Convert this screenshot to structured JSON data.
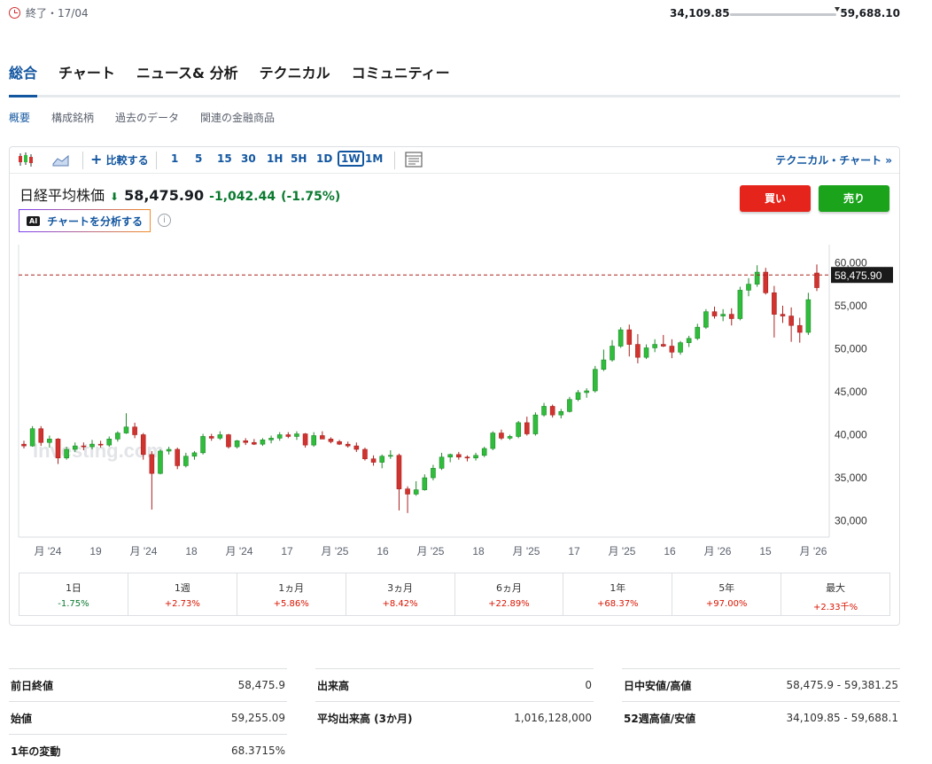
{
  "status": {
    "label": "終了・17/04"
  },
  "range52": {
    "label": "52週高値/安値",
    "low": "34,109.85",
    "high": "59,688.10"
  },
  "tabs": [
    {
      "label": "総合",
      "active": true
    },
    {
      "label": "チャート"
    },
    {
      "label": "ニュース& 分析"
    },
    {
      "label": "テクニカル"
    },
    {
      "label": "コミュニティー"
    }
  ],
  "subtabs": [
    {
      "label": "概要",
      "active": true
    },
    {
      "label": "構成銘柄"
    },
    {
      "label": "過去のデータ"
    },
    {
      "label": "関連の金融商品"
    }
  ],
  "toolbar": {
    "compare": "比較する",
    "intervals": [
      "1",
      "5",
      "15",
      "30",
      "1H",
      "5H",
      "1D",
      "1W",
      "1M"
    ],
    "selected_interval": "1W",
    "technical_link": "テクニカル・チャート »"
  },
  "instrument": {
    "name": "日経平均株価",
    "price": "58,475.90",
    "change": "-1,042.44",
    "change_pct": "(-1.75%)"
  },
  "ai_button": {
    "badge": "AI",
    "label": "チャートを分析する"
  },
  "buy_label": "買い",
  "sell_label": "売り",
  "chart_data": {
    "type": "candlestick",
    "current_price_label": "58,475.90",
    "current_price": 58475.9,
    "ylim": [
      28000,
      62000
    ],
    "y_ticks": [
      "60,000",
      "55,000",
      "50,000",
      "45,000",
      "40,000",
      "35,000",
      "30,000"
    ],
    "x_tick_labels": [
      "月 '24",
      "19",
      "月 '24",
      "18",
      "月 '24",
      "17",
      "月 '25",
      "16",
      "月 '25",
      "18",
      "月 '25",
      "17",
      "月 '25",
      "16",
      "月 '26",
      "15",
      "月 '26"
    ],
    "watermark": "Investing.com",
    "colors": {
      "up": "#2fbd3b",
      "down": "#d1332f"
    },
    "candles": [
      [
        38800,
        39200,
        38300,
        38600
      ],
      [
        38600,
        40900,
        38500,
        40600
      ],
      [
        40600,
        40900,
        38600,
        39000
      ],
      [
        39000,
        39800,
        38400,
        39400
      ],
      [
        39400,
        39500,
        36500,
        37200
      ],
      [
        37200,
        38500,
        37000,
        38200
      ],
      [
        38200,
        39000,
        37900,
        38600
      ],
      [
        38600,
        39000,
        38100,
        38500
      ],
      [
        38500,
        39300,
        38200,
        38800
      ],
      [
        38800,
        39200,
        38400,
        38700
      ],
      [
        38700,
        39700,
        38500,
        39400
      ],
      [
        39400,
        40300,
        39100,
        40100
      ],
      [
        40100,
        42400,
        40000,
        40800
      ],
      [
        40800,
        41300,
        39500,
        39900
      ],
      [
        39900,
        40100,
        37000,
        37600
      ],
      [
        37600,
        38000,
        31200,
        35400
      ],
      [
        35400,
        38200,
        35300,
        38000
      ],
      [
        38000,
        38500,
        37600,
        38200
      ],
      [
        38200,
        38400,
        35900,
        36300
      ],
      [
        36300,
        37800,
        36100,
        37400
      ],
      [
        37400,
        38000,
        37000,
        37800
      ],
      [
        37800,
        40000,
        37600,
        39700
      ],
      [
        39700,
        40000,
        39200,
        39500
      ],
      [
        39500,
        40300,
        39300,
        39900
      ],
      [
        39900,
        40000,
        38300,
        38500
      ],
      [
        38500,
        39300,
        38300,
        39200
      ],
      [
        39200,
        39500,
        38700,
        39000
      ],
      [
        39000,
        39400,
        38700,
        38800
      ],
      [
        38800,
        39500,
        38600,
        39300
      ],
      [
        39300,
        39800,
        38900,
        39500
      ],
      [
        39500,
        40200,
        39200,
        39900
      ],
      [
        39900,
        40200,
        39500,
        39700
      ],
      [
        39700,
        40300,
        39300,
        40000
      ],
      [
        40000,
        40100,
        38400,
        38700
      ],
      [
        38700,
        40200,
        38500,
        39800
      ],
      [
        39800,
        40300,
        39400,
        39400
      ],
      [
        39400,
        39600,
        38900,
        39100
      ],
      [
        39100,
        39300,
        38700,
        38800
      ],
      [
        38800,
        39100,
        38400,
        38600
      ],
      [
        38600,
        39000,
        37900,
        38200
      ],
      [
        38200,
        38400,
        36900,
        37100
      ],
      [
        37100,
        37500,
        36300,
        36700
      ],
      [
        36700,
        37600,
        36000,
        37400
      ],
      [
        37400,
        38100,
        37100,
        37500
      ],
      [
        37500,
        37700,
        31100,
        33600
      ],
      [
        33600,
        33900,
        30800,
        33000
      ],
      [
        33000,
        34500,
        32800,
        33500
      ],
      [
        33500,
        35300,
        33400,
        34900
      ],
      [
        34900,
        36400,
        34600,
        36000
      ],
      [
        36000,
        37800,
        35800,
        37300
      ],
      [
        37300,
        37700,
        36700,
        37600
      ],
      [
        37600,
        37900,
        37000,
        37300
      ],
      [
        37300,
        37500,
        36800,
        37200
      ],
      [
        37200,
        37800,
        36900,
        37500
      ],
      [
        37500,
        38500,
        37300,
        38300
      ],
      [
        38300,
        40300,
        38100,
        40100
      ],
      [
        40100,
        40500,
        39300,
        39500
      ],
      [
        39500,
        39900,
        39300,
        39700
      ],
      [
        39700,
        41500,
        39500,
        41300
      ],
      [
        41300,
        42000,
        39800,
        40000
      ],
      [
        40000,
        42500,
        39800,
        42200
      ],
      [
        42200,
        43600,
        42000,
        43200
      ],
      [
        43200,
        43400,
        41900,
        42200
      ],
      [
        42200,
        42900,
        41800,
        42600
      ],
      [
        42600,
        44300,
        42500,
        44000
      ],
      [
        44000,
        45100,
        43800,
        44800
      ],
      [
        44800,
        45300,
        44200,
        45000
      ],
      [
        45000,
        47900,
        44800,
        47500
      ],
      [
        47500,
        49800,
        47300,
        48600
      ],
      [
        48600,
        50900,
        48400,
        50200
      ],
      [
        50200,
        52400,
        50000,
        52100
      ],
      [
        52100,
        52700,
        49000,
        50400
      ],
      [
        50400,
        51600,
        48200,
        48900
      ],
      [
        48900,
        50400,
        48700,
        50000
      ],
      [
        50000,
        51000,
        49500,
        50400
      ],
      [
        50400,
        51500,
        50100,
        50200
      ],
      [
        50200,
        51000,
        48800,
        49500
      ],
      [
        49500,
        50800,
        49200,
        50600
      ],
      [
        50600,
        51400,
        50100,
        51100
      ],
      [
        51100,
        52800,
        50900,
        52400
      ],
      [
        52400,
        54500,
        52200,
        54200
      ],
      [
        54200,
        54800,
        53400,
        53700
      ],
      [
        53700,
        54500,
        53100,
        53900
      ],
      [
        53900,
        54600,
        52600,
        53400
      ],
      [
        53400,
        57100,
        53200,
        56700
      ],
      [
        56700,
        58100,
        56000,
        57400
      ],
      [
        57400,
        59600,
        57100,
        58800
      ],
      [
        58800,
        59300,
        56200,
        56400
      ],
      [
        56400,
        57200,
        51200,
        53900
      ],
      [
        53900,
        54900,
        52900,
        53700
      ],
      [
        53700,
        54700,
        50700,
        52600
      ],
      [
        52600,
        53500,
        50600,
        51800
      ],
      [
        51800,
        56400,
        51500,
        55600
      ],
      [
        58700,
        59700,
        56600,
        57000
      ]
    ]
  },
  "performance": [
    {
      "label": "1日",
      "value": "-1.75%",
      "dir": "neg"
    },
    {
      "label": "1週",
      "value": "+2.73%",
      "dir": "pos"
    },
    {
      "label": "1ヵ月",
      "value": "+5.86%",
      "dir": "pos"
    },
    {
      "label": "3ヵ月",
      "value": "+8.42%",
      "dir": "pos"
    },
    {
      "label": "6ヵ月",
      "value": "+22.89%",
      "dir": "pos"
    },
    {
      "label": "1年",
      "value": "+68.37%",
      "dir": "pos"
    },
    {
      "label": "5年",
      "value": "+97.00%",
      "dir": "pos"
    },
    {
      "label": "最大",
      "value": "+2.33千%",
      "dir": "pos"
    }
  ],
  "stats": {
    "col1": [
      {
        "k": "前日終値",
        "v": "58,475.9"
      },
      {
        "k": "始値",
        "v": "59,255.09"
      },
      {
        "k": "1年の変動",
        "v": "68.3715%"
      }
    ],
    "col2": [
      {
        "k": "出来高",
        "v": "0"
      },
      {
        "k": "平均出来高 (3か月)",
        "v": "1,016,128,000"
      }
    ],
    "col3": [
      {
        "k": "日中安値/高値",
        "v": "58,475.9 - 59,381.25"
      },
      {
        "k": "52週高値/安値",
        "v": "34,109.85 - 59,688.1"
      }
    ]
  }
}
